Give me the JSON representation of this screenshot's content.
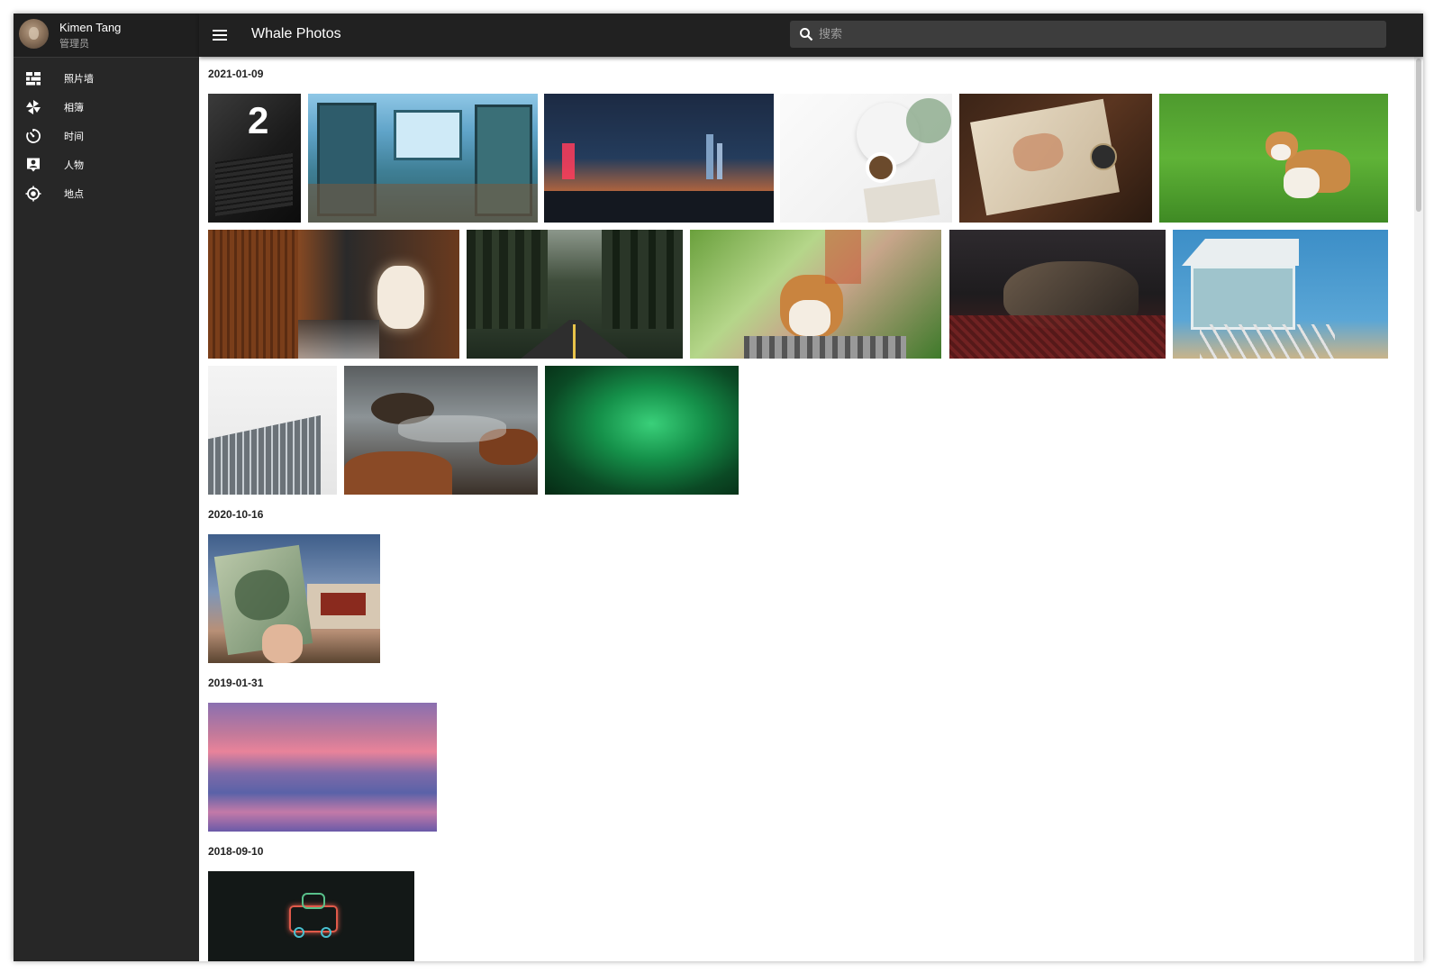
{
  "user": {
    "name": "Kimen Tang",
    "role": "管理员"
  },
  "app": {
    "title": "Whale Photos"
  },
  "search": {
    "placeholder": "搜索"
  },
  "nav": [
    {
      "label": "照片墙",
      "icon": "photo-wall-icon"
    },
    {
      "label": "相簿",
      "icon": "album-pinwheel-icon"
    },
    {
      "label": "时间",
      "icon": "timer-icon"
    },
    {
      "label": "人物",
      "icon": "person-card-icon"
    },
    {
      "label": "地点",
      "icon": "location-target-icon"
    }
  ],
  "groups": [
    {
      "date": "2021-01-09",
      "photos": [
        {
          "subject": "laptop with 24 calendar"
        },
        {
          "subject": "anime dorm room with bunk beds"
        },
        {
          "subject": "neon city street at night"
        },
        {
          "subject": "coffee cup and book on white table"
        },
        {
          "subject": "world map with compass on leaves"
        },
        {
          "subject": "corgi puppy on green grass"
        },
        {
          "subject": "japanese alley with lantern"
        },
        {
          "subject": "road through redwood forest"
        },
        {
          "subject": "corgi running on railway"
        },
        {
          "subject": "dog sleeping on cushion"
        },
        {
          "subject": "lifeguard tower by sea"
        },
        {
          "subject": "modern glass building"
        },
        {
          "subject": "rocky coast with waves"
        },
        {
          "subject": "green aurora"
        }
      ]
    },
    {
      "date": "2020-10-16",
      "photos": [
        {
          "subject": "50 yuan banknote with potala palace"
        }
      ]
    },
    {
      "date": "2019-01-31",
      "photos": [
        {
          "subject": "pink purple sunset over sea"
        }
      ]
    },
    {
      "date": "2018-09-10",
      "photos": [
        {
          "subject": "neon van sign on dark wall"
        }
      ]
    }
  ]
}
